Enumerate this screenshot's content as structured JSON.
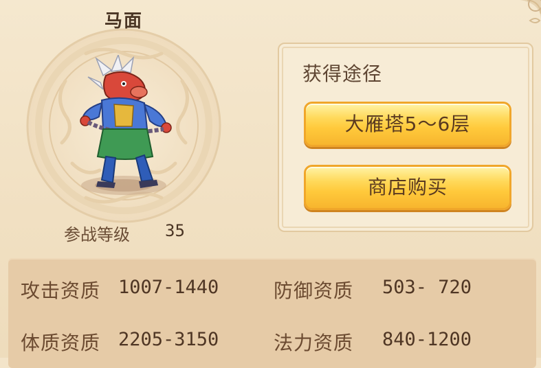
{
  "pet": {
    "name": "马面",
    "level_label": "参战等级",
    "level_value": "35"
  },
  "acquisition": {
    "title": "获得途径",
    "buttons": [
      {
        "label": "大雁塔5～6层"
      },
      {
        "label": "商店购买"
      }
    ]
  },
  "stats": [
    {
      "label": "攻击资质",
      "value": "1007-1440"
    },
    {
      "label": "防御资质",
      "value": "503- 720"
    },
    {
      "label": "体质资质",
      "value": "2205-3150"
    },
    {
      "label": "法力资质",
      "value": "840-1200"
    }
  ],
  "colors": {
    "background": "#f3e4c9",
    "button_gold": "#ffc93b",
    "stats_panel": "#e6cba7"
  },
  "icons": {
    "emblem": "ornamental-circle-emblem",
    "pet_sprite": "horse-face-demon-sprite"
  }
}
